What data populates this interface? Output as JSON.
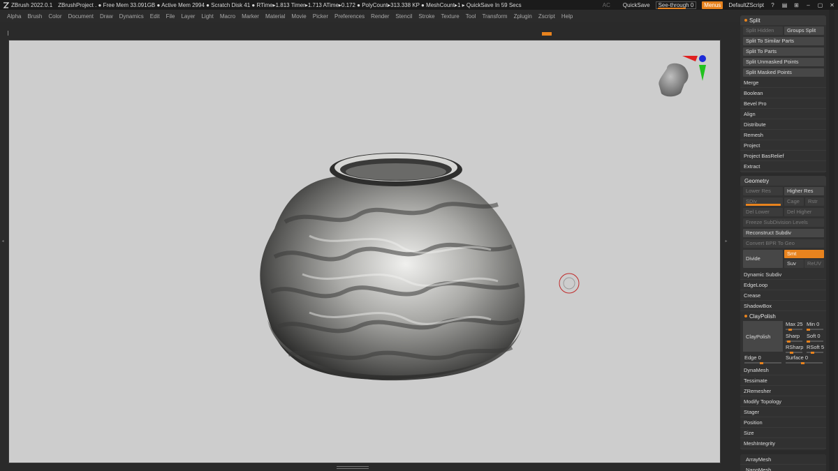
{
  "titlebar": {
    "app_title": "ZBrush 2022.0.1",
    "status": "ZBrushProject  . ● Free Mem 33.091GB ● Active Mem 2994 ● Scratch Disk 41 ●  RTime▸1.813 Timer▸1.713 ATime▸0.172 ● PolyCount▸313.338 KP ● MeshCount▸1  ▸ QuickSave In 59 Secs",
    "ac": "AC",
    "quicksave": "QuickSave",
    "see_through": "See-through  0",
    "menus": "Menus",
    "script": "DefaultZScript"
  },
  "menubar": [
    "Alpha",
    "Brush",
    "Color",
    "Document",
    "Draw",
    "Dynamics",
    "Edit",
    "File",
    "Layer",
    "Light",
    "Macro",
    "Marker",
    "Material",
    "Movie",
    "Picker",
    "Preferences",
    "Render",
    "Stencil",
    "Stroke",
    "Texture",
    "Tool",
    "Transform",
    "Zplugin",
    "Zscript",
    "Help"
  ],
  "split_group": {
    "header": "Split",
    "row1": [
      "Split Hidden",
      "Groups Split"
    ],
    "buttons": [
      "Split To Similar Parts",
      "Split To Parts",
      "Split Unmasked Points",
      "Split Masked Points"
    ],
    "items": [
      "Merge",
      "Boolean",
      "Bevel Pro",
      "Align",
      "Distribute",
      "Remesh",
      "Project",
      "Project BasRelief",
      "Extract"
    ]
  },
  "geometry_group": {
    "header": "Geometry",
    "lower_res": "Lower Res",
    "higher_res": "Higher Res",
    "sdiv": "SDiv",
    "cage": "Cage",
    "rstr": "Rstr",
    "del_lower": "Del Lower",
    "del_higher": "Del Higher",
    "freeze": "Freeze SubDivision Levels",
    "reconstruct": "Reconstruct Subdiv",
    "convert": "Convert BPR To Geo",
    "divide": "Divide",
    "smt": "Smt",
    "suv": "Suv",
    "reuv": "ReUV",
    "items": [
      "Dynamic Subdiv",
      "EdgeLoop",
      "Crease",
      "ShadowBox"
    ]
  },
  "claypolish": {
    "header": "ClayPolish",
    "button": "ClayPolish",
    "max": "Max 25",
    "min": "Min 0",
    "sharp": "Sharp",
    "soft": "Soft 0",
    "rsharp": "RSharp",
    "rsoft": "RSoft 5",
    "edge": "Edge 0",
    "surface": "Surface 0"
  },
  "tail_items": [
    "DynaMesh",
    "Tessimate",
    "ZRemesher",
    "Modify Topology",
    "Stager",
    "Position",
    "Size",
    "MeshIntegrity"
  ],
  "bottom_items": [
    "ArrayMesh",
    "NanoMesh"
  ]
}
